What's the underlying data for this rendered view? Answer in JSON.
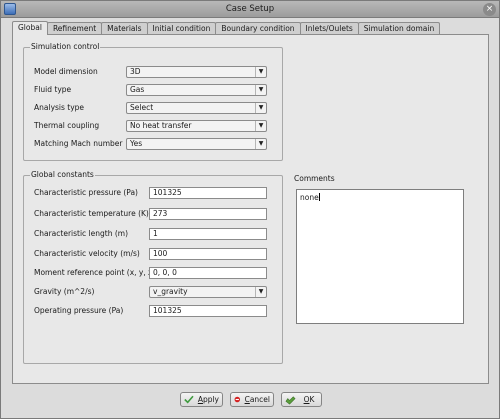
{
  "window": {
    "title": "Case Setup"
  },
  "tabs": [
    {
      "label": "Global",
      "active": true
    },
    {
      "label": "Refinement"
    },
    {
      "label": "Materials"
    },
    {
      "label": "Initial condition"
    },
    {
      "label": "Boundary condition"
    },
    {
      "label": "Inlets/Oulets"
    },
    {
      "label": "Simulation domain"
    }
  ],
  "simulation_control": {
    "title": "Simulation control",
    "rows": [
      {
        "label": "Model dimension",
        "value": "3D"
      },
      {
        "label": "Fluid type",
        "value": "Gas"
      },
      {
        "label": "Analysis type",
        "value": "Select"
      },
      {
        "label": "Thermal coupling",
        "value": "No heat transfer"
      },
      {
        "label": "Matching Mach number",
        "value": "Yes"
      }
    ]
  },
  "global_constants": {
    "title": "Global constants",
    "rows": [
      {
        "label": "Characteristic pressure (Pa)",
        "value": "101325"
      },
      {
        "label": "Characteristic temperature (K)",
        "value": "273"
      },
      {
        "label": "Characteristic length (m)",
        "value": "1"
      },
      {
        "label": "Characteristic velocity (m/s)",
        "value": "100"
      },
      {
        "label": "Moment reference point (x, y, z)",
        "value": "0, 0, 0"
      },
      {
        "label": "Gravity (m^2/s)",
        "value": "v_gravity"
      },
      {
        "label": "Operating pressure (Pa)",
        "value": "101325"
      }
    ]
  },
  "comments": {
    "label": "Comments",
    "value": "none"
  },
  "buttons": {
    "apply": {
      "label": "Apply",
      "mnemonic": "A",
      "rest": "pply",
      "icon": "check-icon"
    },
    "cancel": {
      "label": "Cancel",
      "mnemonic": "C",
      "rest": "ancel",
      "icon": "cancel-icon"
    },
    "ok": {
      "label": "OK",
      "mnemonic": "O",
      "rest": "K",
      "icon": "ok-icon"
    }
  },
  "colors": {
    "apply_check": "#3f9b3f",
    "cancel_red": "#d42020",
    "ok_green": "#5a9e3c"
  }
}
